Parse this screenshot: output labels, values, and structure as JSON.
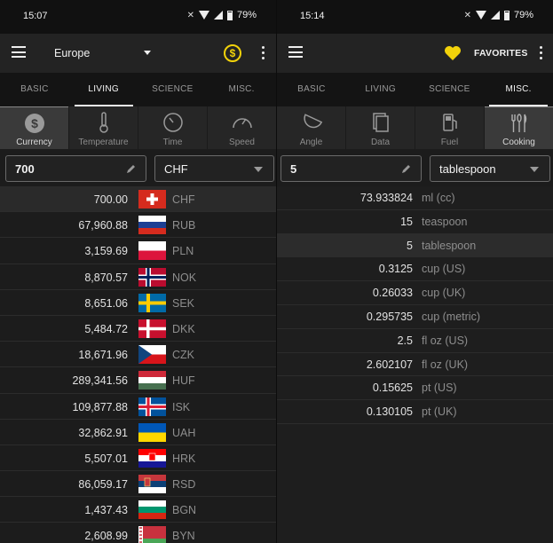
{
  "left": {
    "status": {
      "time": "15:07",
      "battery": "79%"
    },
    "toolbar": {
      "region": "Europe"
    },
    "tabs": [
      {
        "label": "BASIC",
        "active": false
      },
      {
        "label": "LIVING",
        "active": true
      },
      {
        "label": "SCIENCE",
        "active": false
      },
      {
        "label": "MISC.",
        "active": false
      }
    ],
    "subtabs": [
      {
        "label": "Currency",
        "icon": "dollar-coin-icon",
        "active": true
      },
      {
        "label": "Temperature",
        "icon": "thermometer-icon",
        "active": false
      },
      {
        "label": "Time",
        "icon": "clock-icon",
        "active": false
      },
      {
        "label": "Speed",
        "icon": "speedometer-icon",
        "active": false
      }
    ],
    "input": {
      "value": "700",
      "unit": "CHF"
    },
    "rows": [
      {
        "amount": "700.00",
        "code": "CHF",
        "flag": "switzerland-flag-icon",
        "selected": true
      },
      {
        "amount": "67,960.88",
        "code": "RUB",
        "flag": "russia-flag-icon",
        "selected": false
      },
      {
        "amount": "3,159.69",
        "code": "PLN",
        "flag": "poland-flag-icon",
        "selected": false
      },
      {
        "amount": "8,870.57",
        "code": "NOK",
        "flag": "norway-flag-icon",
        "selected": false
      },
      {
        "amount": "8,651.06",
        "code": "SEK",
        "flag": "sweden-flag-icon",
        "selected": false
      },
      {
        "amount": "5,484.72",
        "code": "DKK",
        "flag": "denmark-flag-icon",
        "selected": false
      },
      {
        "amount": "18,671.96",
        "code": "CZK",
        "flag": "czechia-flag-icon",
        "selected": false
      },
      {
        "amount": "289,341.56",
        "code": "HUF",
        "flag": "hungary-flag-icon",
        "selected": false
      },
      {
        "amount": "109,877.88",
        "code": "ISK",
        "flag": "iceland-flag-icon",
        "selected": false
      },
      {
        "amount": "32,862.91",
        "code": "UAH",
        "flag": "ukraine-flag-icon",
        "selected": false
      },
      {
        "amount": "5,507.01",
        "code": "HRK",
        "flag": "croatia-flag-icon",
        "selected": false
      },
      {
        "amount": "86,059.17",
        "code": "RSD",
        "flag": "serbia-flag-icon",
        "selected": false
      },
      {
        "amount": "1,437.43",
        "code": "BGN",
        "flag": "bulgaria-flag-icon",
        "selected": false
      },
      {
        "amount": "2,608.99",
        "code": "BYN",
        "flag": "belarus-flag-icon",
        "selected": false
      }
    ]
  },
  "right": {
    "status": {
      "time": "15:14",
      "battery": "79%"
    },
    "toolbar": {
      "favorites": "FAVORITES"
    },
    "tabs": [
      {
        "label": "BASIC",
        "active": false
      },
      {
        "label": "LIVING",
        "active": false
      },
      {
        "label": "SCIENCE",
        "active": false
      },
      {
        "label": "MISC.",
        "active": true
      }
    ],
    "subtabs": [
      {
        "label": "Angle",
        "icon": "angle-icon",
        "active": false
      },
      {
        "label": "Data",
        "icon": "data-files-icon",
        "active": false
      },
      {
        "label": "Fuel",
        "icon": "fuel-pump-icon",
        "active": false
      },
      {
        "label": "Cooking",
        "icon": "cutlery-icon",
        "active": true
      }
    ],
    "input": {
      "value": "5",
      "unit": "tablespoon"
    },
    "rows": [
      {
        "value": "73.933824",
        "unit": "ml (cc)",
        "selected": false
      },
      {
        "value": "15",
        "unit": "teaspoon",
        "selected": false
      },
      {
        "value": "5",
        "unit": "tablespoon",
        "selected": true
      },
      {
        "value": "0.3125",
        "unit": "cup (US)",
        "selected": false
      },
      {
        "value": "0.26033",
        "unit": "cup (UK)",
        "selected": false
      },
      {
        "value": "0.295735",
        "unit": "cup (metric)",
        "selected": false
      },
      {
        "value": "2.5",
        "unit": "fl oz (US)",
        "selected": false
      },
      {
        "value": "2.602107",
        "unit": "fl oz (UK)",
        "selected": false
      },
      {
        "value": "0.15625",
        "unit": "pt (US)",
        "selected": false
      },
      {
        "value": "0.130105",
        "unit": "pt (UK)",
        "selected": false
      }
    ]
  },
  "colors": {
    "accent_yellow": "#f2d20a",
    "background": "#1c1c1c",
    "selected_row": "#2a2a2a"
  }
}
